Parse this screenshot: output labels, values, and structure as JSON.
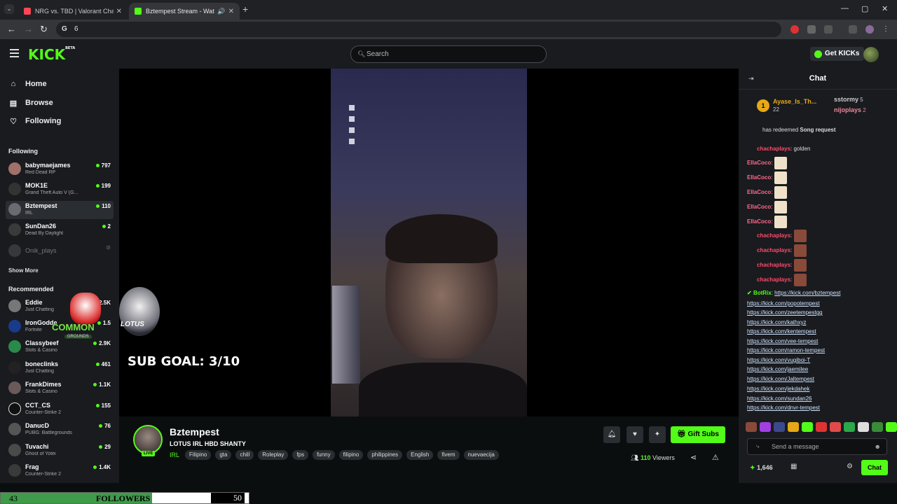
{
  "browser": {
    "tabs": [
      {
        "title": "NRG vs. TBD | Valorant Champi",
        "active": false
      },
      {
        "title": "Bztempest Stream - Watch",
        "active": true
      }
    ],
    "address": "6"
  },
  "header": {
    "logo": "KICK",
    "logo_tag": "BETA",
    "search_placeholder": "Search",
    "get_kicks": "Get KICKs"
  },
  "nav": {
    "home": "Home",
    "browse": "Browse",
    "following": "Following"
  },
  "sidebar": {
    "following_title": "Following",
    "following": [
      {
        "name": "babymaejames",
        "category": "Red Dead RP",
        "viewers": "797"
      },
      {
        "name": "MOK1E",
        "category": "Grand Theft Auto V (G...",
        "viewers": "199"
      },
      {
        "name": "Bztempest",
        "category": "IRL",
        "viewers": "110"
      },
      {
        "name": "SunDan26",
        "category": "Dead By Daylight",
        "viewers": "2"
      },
      {
        "name": "Onik_plays",
        "category": "",
        "viewers": ""
      }
    ],
    "show_more": "Show More",
    "recommended_title": "Recommended",
    "recommended": [
      {
        "name": "Eddie",
        "category": "Just Chatting",
        "viewers": "2.5K"
      },
      {
        "name": "IronGodde",
        "category": "Fortnite",
        "viewers": "1.5"
      },
      {
        "name": "Classybeef",
        "category": "Slots & Casino",
        "viewers": "2.9K"
      },
      {
        "name": "boneclinks",
        "category": "Just Chatting",
        "viewers": "461"
      },
      {
        "name": "FrankDimes",
        "category": "Slots & Casino",
        "viewers": "1.1K"
      },
      {
        "name": "CCT_CS",
        "category": "Counter-Strike 2",
        "viewers": "155"
      },
      {
        "name": "DanucD",
        "category": "PUBG: Battlegrounds",
        "viewers": "76"
      },
      {
        "name": "Tuvachi",
        "category": "Ghost of Yotei",
        "viewers": "29"
      },
      {
        "name": "Frag",
        "category": "Counter-Strike 2",
        "viewers": "1.4K"
      }
    ]
  },
  "stream": {
    "sub_goal": "SUB GOAL: 3/10",
    "lotus": "LOTUS",
    "common": "COMMON",
    "grounds": "GROUNDS",
    "streamer": "Bztempest",
    "title": "LOTUS IRL HBD SHANTY",
    "category": "IRL",
    "live": "LIVE",
    "tags": [
      "Filipino",
      "gta",
      "chill",
      "Roleplay",
      "fps",
      "funny",
      "filipino",
      "philippines",
      "English",
      "fivem",
      "nuevaecija"
    ],
    "gift_subs": "Gift Subs",
    "viewers_count": "110",
    "viewers_label": "Viewers"
  },
  "chat": {
    "title": "Chat",
    "leaderboard": [
      {
        "rank": "1",
        "name": "Ayase_Is_Th...",
        "count": "22"
      },
      {
        "name": "sstormy",
        "count": "5"
      },
      {
        "name": "nijoplays",
        "count": "2"
      }
    ],
    "redeem_text": "has redeemed",
    "redeem_item": "Song request",
    "messages": [
      {
        "user": "chachaplays",
        "text": ": golden"
      },
      {
        "user": "EllaCoco",
        "text": ":"
      },
      {
        "user": "EllaCoco",
        "text": ":"
      },
      {
        "user": "EllaCoco",
        "text": ":"
      },
      {
        "user": "EllaCoco",
        "text": ":"
      },
      {
        "user": "EllaCoco",
        "text": ":"
      },
      {
        "user": "chachaplays",
        "text": ":"
      },
      {
        "user": "chachaplays",
        "text": ":"
      },
      {
        "user": "chachaplays",
        "text": ":"
      },
      {
        "user": "chachaplays",
        "text": ":"
      }
    ],
    "bot_user": "BotRix",
    "links": [
      "https://kick.com/bztempest",
      "https://kick.com/popotempest",
      "https://kick.com/zeetempestgg",
      "https://kick.com/kathxyz",
      "https://kick.com/kentempest",
      "https://kick.com/vee-tempest",
      "https://kick.com/ramon-tempest",
      "https://kick.com/vugiboi-T",
      "https://kick.com/jaemilee",
      "https://kick.com/Jaltempest",
      "https://kick.com/jekdahek",
      "https://kick.com/sundan26",
      "https://kick.com/dnvr-tempest"
    ],
    "input_placeholder": "Send a message",
    "points": "1,646",
    "send_label": "Chat"
  },
  "follower_goal": {
    "current": "43",
    "label": "FOLLOWERS",
    "target": "50",
    "progress": 0.86
  },
  "colors": {
    "accent": "#53fc18",
    "background": "#191b1f"
  }
}
